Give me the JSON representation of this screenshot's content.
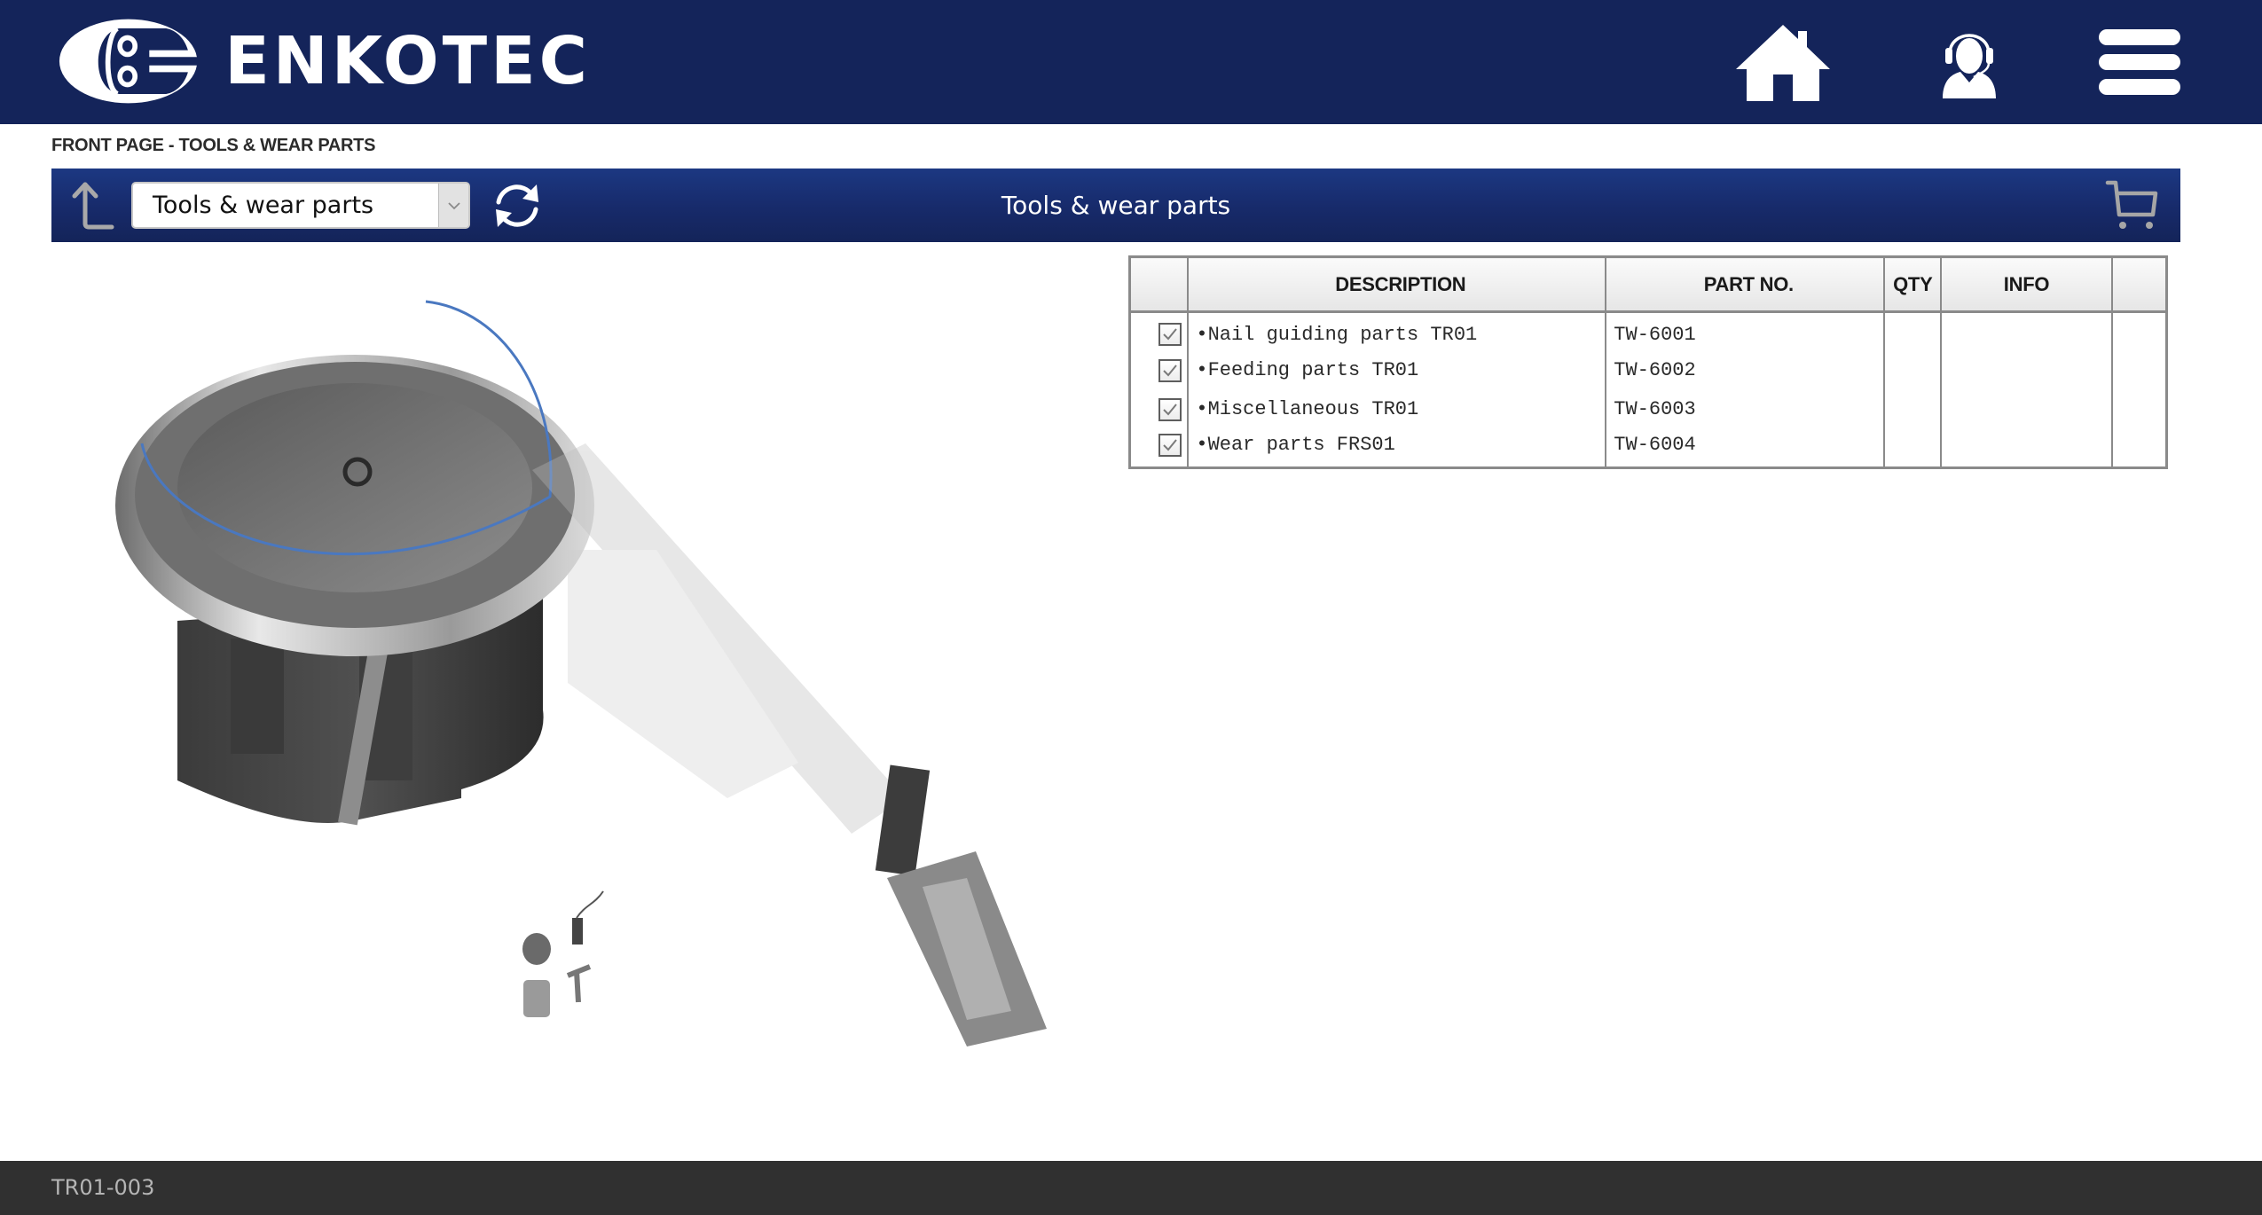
{
  "header": {
    "brand_name": "ENKOTEC",
    "icons": {
      "home": "home-icon",
      "support": "support-headset-icon",
      "menu": "hamburger-menu-icon"
    },
    "colors": {
      "background": "#14245a",
      "icon": "#ffffff"
    }
  },
  "breadcrumb": "FRONT PAGE - TOOLS & WEAR PARTS",
  "toolbar": {
    "back_icon": "arrow-up-back-icon",
    "section_select": {
      "value": "Tools & wear parts"
    },
    "refresh_icon": "refresh-icon",
    "title": "Tools & wear parts",
    "cart_icon": "shopping-cart-icon"
  },
  "table": {
    "columns": [
      "",
      "DESCRIPTION",
      "PART NO.",
      "QTY",
      "INFO",
      ""
    ],
    "rows": [
      {
        "checked": true,
        "description": "•Nail guiding parts TR01",
        "part_no": "TW-6001",
        "qty": "",
        "info": ""
      },
      {
        "checked": true,
        "description": "•Feeding parts TR01",
        "part_no": "TW-6002",
        "qty": "",
        "info": ""
      },
      {
        "checked": true,
        "description": "•Miscellaneous TR01",
        "part_no": "TW-6003",
        "qty": "",
        "info": ""
      },
      {
        "checked": true,
        "description": "•Wear parts FRS01",
        "part_no": "TW-6004",
        "qty": "",
        "info": ""
      }
    ]
  },
  "illustration": {
    "subject": "vibratory bowl feeder with linear feed rail and nailing unit (exploded parts view)"
  },
  "footer": {
    "code": "TR01-003"
  }
}
